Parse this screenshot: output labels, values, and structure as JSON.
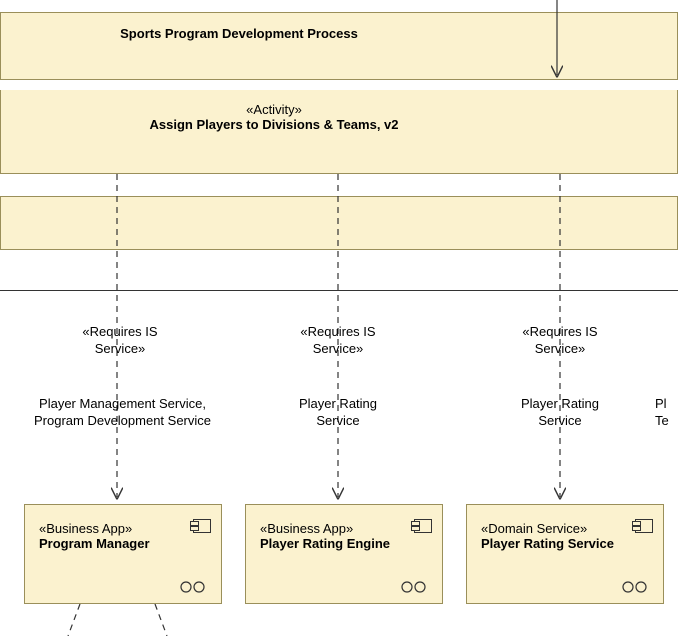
{
  "header": {
    "title": "Sports Program Development Process"
  },
  "activity": {
    "stereotype": "«Activity»",
    "name": "Assign Players to Divisions & Teams, v2"
  },
  "links": [
    {
      "stereotype": "«Requires IS\nService»",
      "name": "Player Management Service,\nProgram Development Service"
    },
    {
      "stereotype": "«Requires IS\nService»",
      "name": "Player Rating\nService"
    },
    {
      "stereotype": "«Requires IS\nService»",
      "name": "Player Rating\nService"
    },
    {
      "name_fragment": "Pl\nTe"
    }
  ],
  "components": [
    {
      "stereotype": "«Business App»",
      "name": "Program Manager"
    },
    {
      "stereotype": "«Business App»",
      "name": "Player Rating Engine"
    },
    {
      "stereotype": "«Domain Service»",
      "name": "Player Rating Service"
    }
  ]
}
